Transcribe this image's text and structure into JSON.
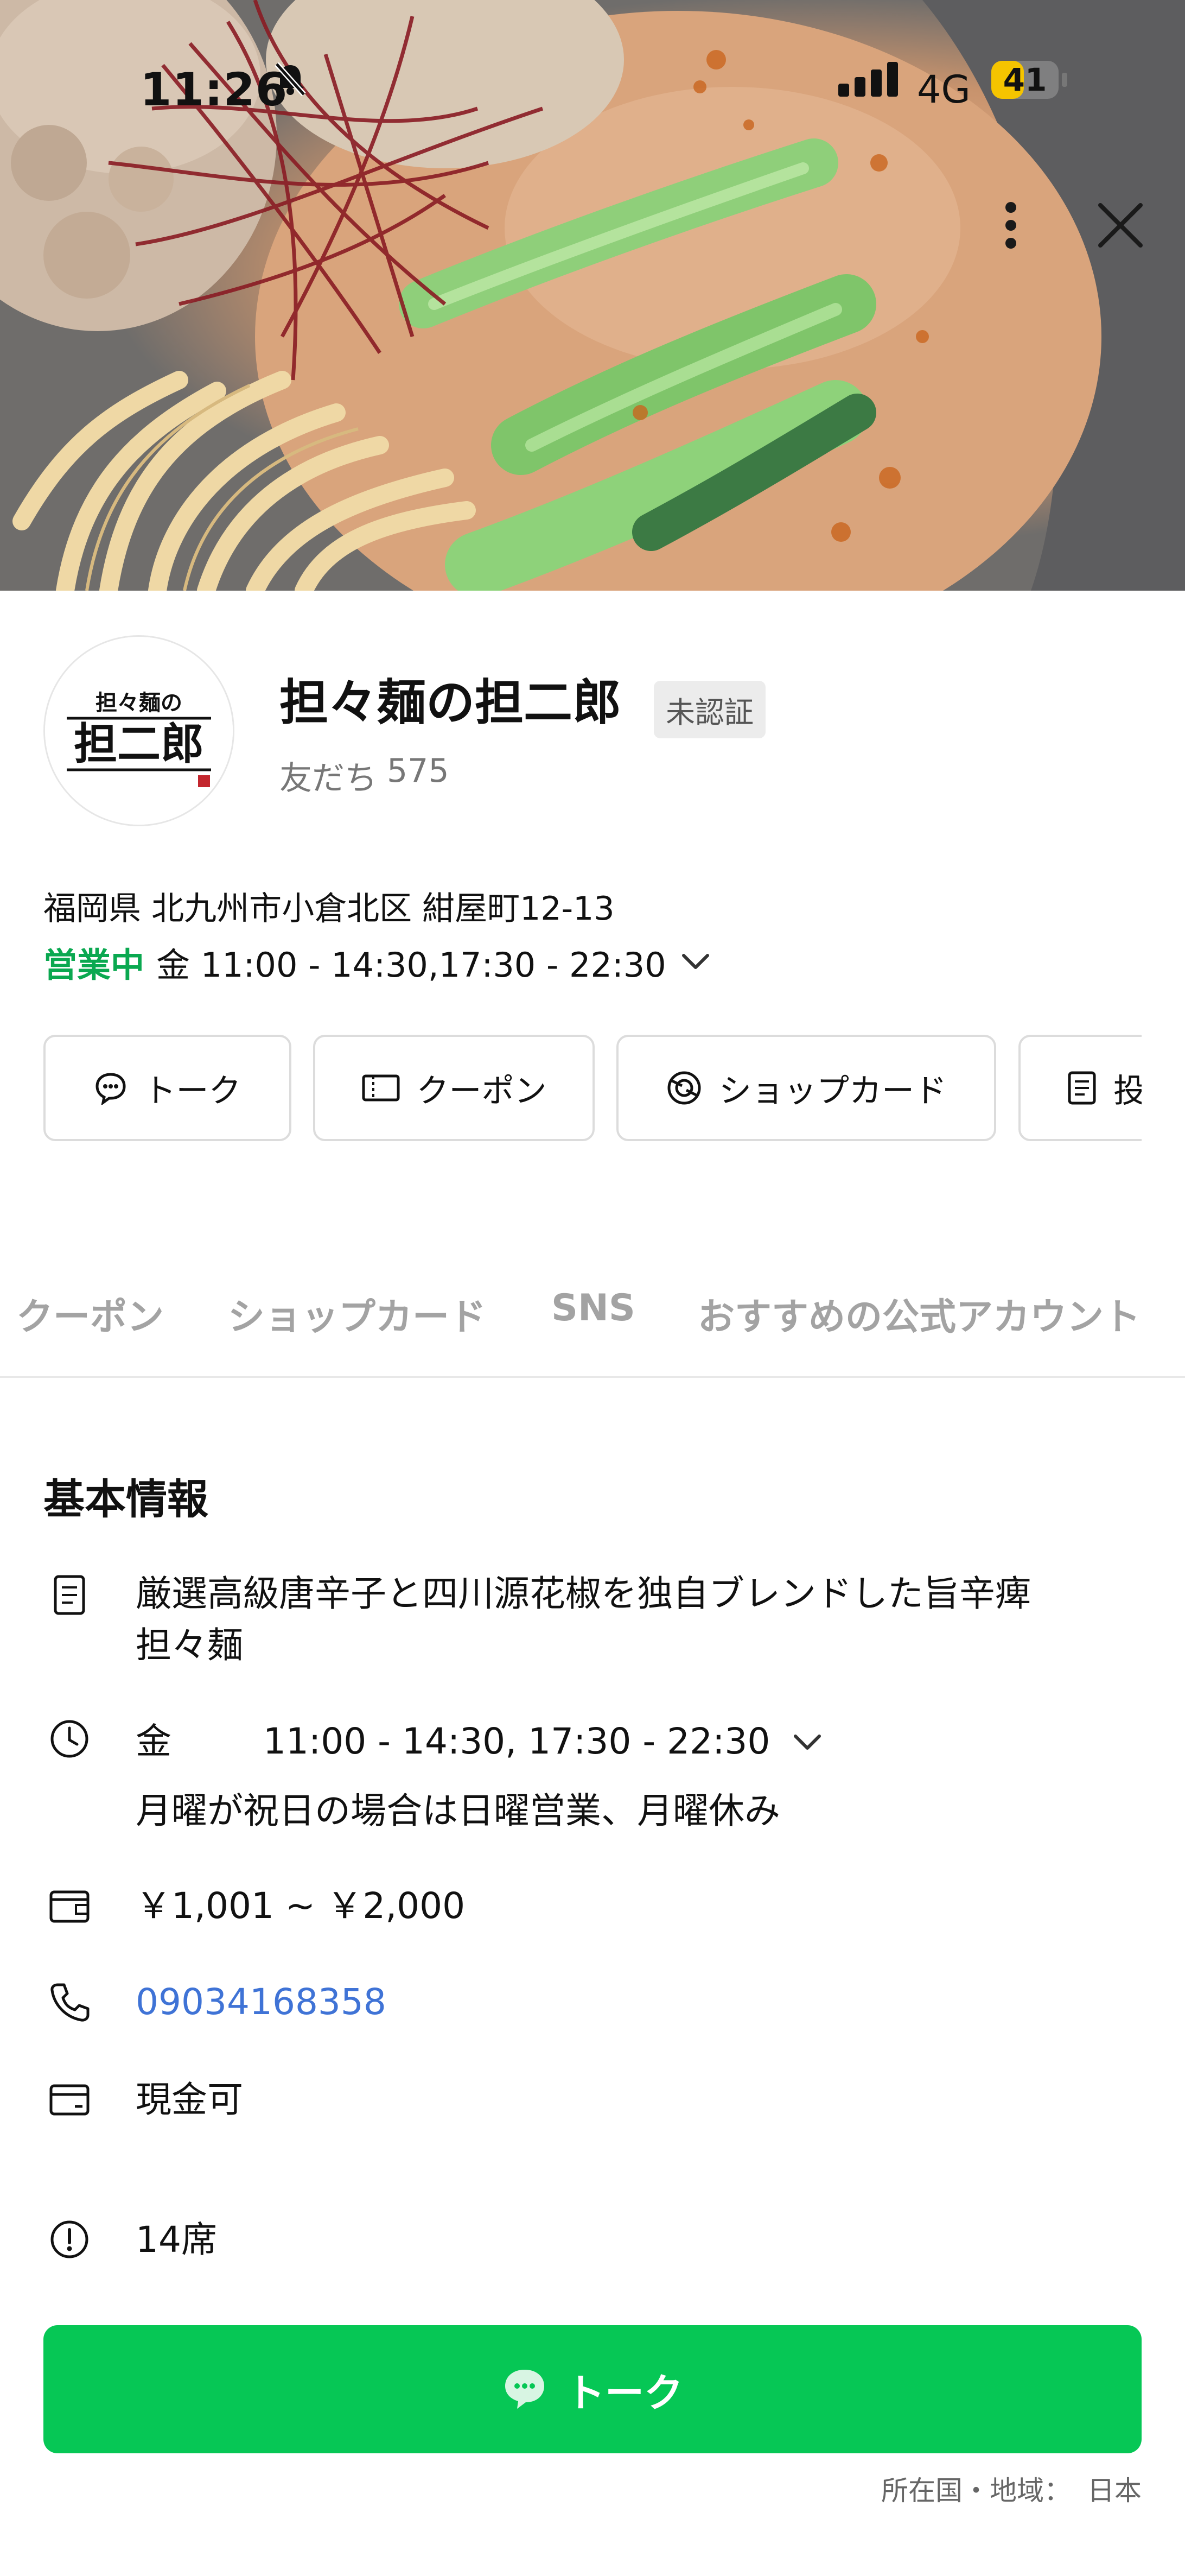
{
  "status_bar": {
    "time": "11:26",
    "network": "4G",
    "battery": "41",
    "icons": [
      "bell-muted-icon",
      "signal-bars-icon",
      "battery-icon"
    ]
  },
  "hero": {
    "image": "tantanmen-noodle-photo",
    "menu_icon": "more-vertical-icon",
    "close_icon": "close-icon"
  },
  "profile": {
    "logo_text": "担々麺の担二郎",
    "name": "担々麺の担二郎",
    "badge": "未認証",
    "friends_label": "友だち",
    "friends_count": "575",
    "address": "福岡県 北九州市小倉北区 紺屋町12-13",
    "open_status": "営業中",
    "hours_summary": "金 11:00 - 14:30,17:30 - 22:30"
  },
  "actions": [
    {
      "label": "トーク",
      "icon": "chat-bubble-icon"
    },
    {
      "label": "クーポン",
      "icon": "coupon-icon"
    },
    {
      "label": "ショップカード",
      "icon": "shop-card-icon"
    },
    {
      "label": "投",
      "icon": "post-icon"
    }
  ],
  "tabs": [
    "クーポン",
    "ショップカード",
    "SNS",
    "おすすめの公式アカウント"
  ],
  "basic_info": {
    "title": "基本情報",
    "description_line1": "厳選高級唐辛子と四川源花椒を独自ブレンドした旨辛痺",
    "description_line2": "担々麺",
    "hours_day": "金",
    "hours_time": "11:00 - 14:30, 17:30 - 22:30",
    "hours_note": "月曜が祝日の場合は日曜営業、月曜休み",
    "price": "￥1,001 ~ ￥2,000",
    "phone": "09034168358",
    "payment": "現金可",
    "seats": "14席"
  },
  "bottom": {
    "talk_button": "トーク",
    "region_label": "所在国・地域：",
    "region_value": "日本"
  },
  "colors": {
    "line_green": "#06c755",
    "open_green": "#0aa850",
    "link_blue": "#3f73d6"
  }
}
